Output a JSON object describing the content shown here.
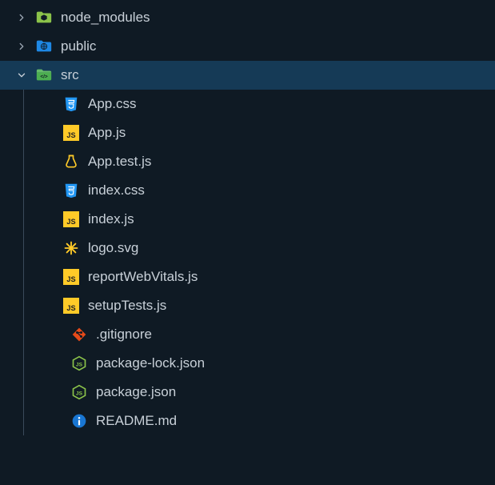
{
  "tree": {
    "folders": [
      {
        "name": "node_modules",
        "icon": "folder-node",
        "expanded": false
      },
      {
        "name": "public",
        "icon": "folder-public",
        "expanded": false
      },
      {
        "name": "src",
        "icon": "folder-src",
        "expanded": true,
        "selected": true
      }
    ],
    "src_children": [
      {
        "name": "App.css",
        "icon": "css"
      },
      {
        "name": "App.js",
        "icon": "js"
      },
      {
        "name": "App.test.js",
        "icon": "test"
      },
      {
        "name": "index.css",
        "icon": "css"
      },
      {
        "name": "index.js",
        "icon": "js"
      },
      {
        "name": "logo.svg",
        "icon": "svg"
      },
      {
        "name": "reportWebVitals.js",
        "icon": "js"
      },
      {
        "name": "setupTests.js",
        "icon": "js"
      }
    ],
    "root_files": [
      {
        "name": ".gitignore",
        "icon": "git"
      },
      {
        "name": "package-lock.json",
        "icon": "nodejs"
      },
      {
        "name": "package.json",
        "icon": "nodejs"
      },
      {
        "name": "README.md",
        "icon": "info"
      }
    ]
  }
}
